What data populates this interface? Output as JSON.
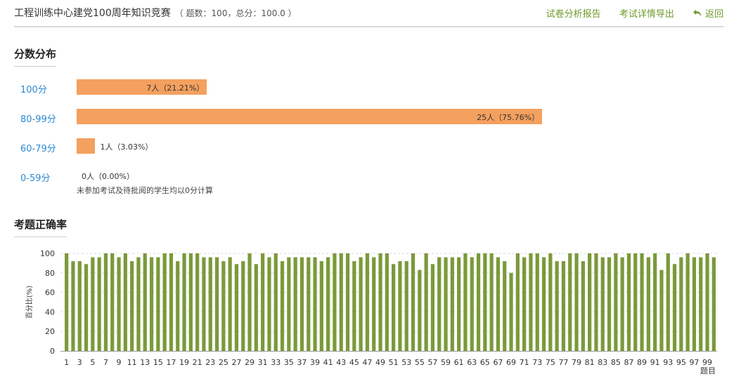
{
  "header": {
    "title": "工程训练中心建党100周年知识竞赛",
    "meta": "（ 题数：100，总分：100.0 ）",
    "links": {
      "analysis_report": "试卷分析报告",
      "export_details": "考试详情导出",
      "back": "返回"
    },
    "colors": {
      "link": "#6f9a2c"
    }
  },
  "distribution": {
    "title": "分数分布",
    "bar_color": "#f4a05f",
    "rows": [
      {
        "label": "100分",
        "text": "7人（21.21%）",
        "percent": 21.21
      },
      {
        "label": "80-99分",
        "text": "25人（75.76%）",
        "percent": 75.76
      },
      {
        "label": "60-79分",
        "text": "1人（3.03%）",
        "percent": 3.03
      },
      {
        "label": "0-59分",
        "text": "0人（0.00%）",
        "percent": 0
      }
    ],
    "note": "未参加考试及待批阅的学生均以0分计算"
  },
  "accuracy": {
    "title": "考题正确率",
    "chart_data": {
      "type": "bar",
      "xlabel": "题目",
      "ylabel": "百分比(%)",
      "ylim": [
        0,
        100
      ],
      "yticks": [
        0,
        20,
        40,
        60,
        80,
        100
      ],
      "grid": true,
      "bar_color": "#7a9a3a",
      "categories": [
        1,
        2,
        3,
        4,
        5,
        6,
        7,
        8,
        9,
        10,
        11,
        12,
        13,
        14,
        15,
        16,
        17,
        18,
        19,
        20,
        21,
        22,
        23,
        24,
        25,
        26,
        27,
        28,
        29,
        30,
        31,
        32,
        33,
        34,
        35,
        36,
        37,
        38,
        39,
        40,
        41,
        42,
        43,
        44,
        45,
        46,
        47,
        48,
        49,
        50,
        51,
        52,
        53,
        54,
        55,
        56,
        57,
        58,
        59,
        60,
        61,
        62,
        63,
        64,
        65,
        66,
        67,
        68,
        69,
        70,
        71,
        72,
        73,
        74,
        75,
        76,
        77,
        78,
        79,
        80,
        81,
        82,
        83,
        84,
        85,
        86,
        87,
        88,
        89,
        90,
        91,
        92,
        93,
        94,
        95,
        96,
        97,
        98,
        99,
        100
      ],
      "values": [
        100,
        92,
        92,
        89,
        96,
        96,
        100,
        100,
        96,
        100,
        92,
        96,
        100,
        96,
        96,
        100,
        100,
        92,
        100,
        100,
        100,
        96,
        96,
        96,
        92,
        96,
        89,
        92,
        100,
        89,
        100,
        96,
        100,
        92,
        96,
        96,
        96,
        96,
        96,
        92,
        96,
        100,
        100,
        100,
        92,
        96,
        100,
        96,
        100,
        100,
        89,
        92,
        92,
        100,
        83,
        100,
        89,
        96,
        96,
        96,
        96,
        100,
        96,
        100,
        100,
        100,
        96,
        92,
        80,
        100,
        96,
        100,
        100,
        96,
        100,
        92,
        92,
        100,
        100,
        92,
        100,
        100,
        96,
        96,
        100,
        96,
        100,
        100,
        100,
        96,
        100,
        83,
        100,
        89,
        96,
        100,
        96,
        96,
        100,
        96
      ]
    }
  }
}
